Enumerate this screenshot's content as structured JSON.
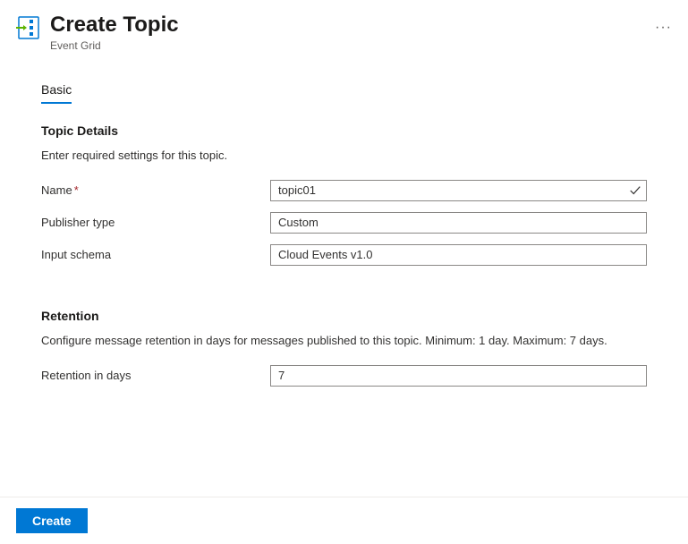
{
  "header": {
    "title": "Create Topic",
    "subtitle": "Event Grid"
  },
  "tabs": [
    {
      "label": "Basic",
      "active": true
    }
  ],
  "sections": {
    "topic_details": {
      "title": "Topic Details",
      "desc": "Enter required settings for this topic.",
      "fields": {
        "name": {
          "label": "Name",
          "required": true,
          "value": "topic01",
          "validated": true
        },
        "publisher_type": {
          "label": "Publisher type",
          "value": "Custom"
        },
        "input_schema": {
          "label": "Input schema",
          "value": "Cloud Events v1.0"
        }
      }
    },
    "retention": {
      "title": "Retention",
      "desc": "Configure message retention in days for messages published to this topic. Minimum: 1 day. Maximum: 7 days.",
      "fields": {
        "retention_days": {
          "label": "Retention in days",
          "value": "7"
        }
      }
    }
  },
  "footer": {
    "create_label": "Create"
  }
}
